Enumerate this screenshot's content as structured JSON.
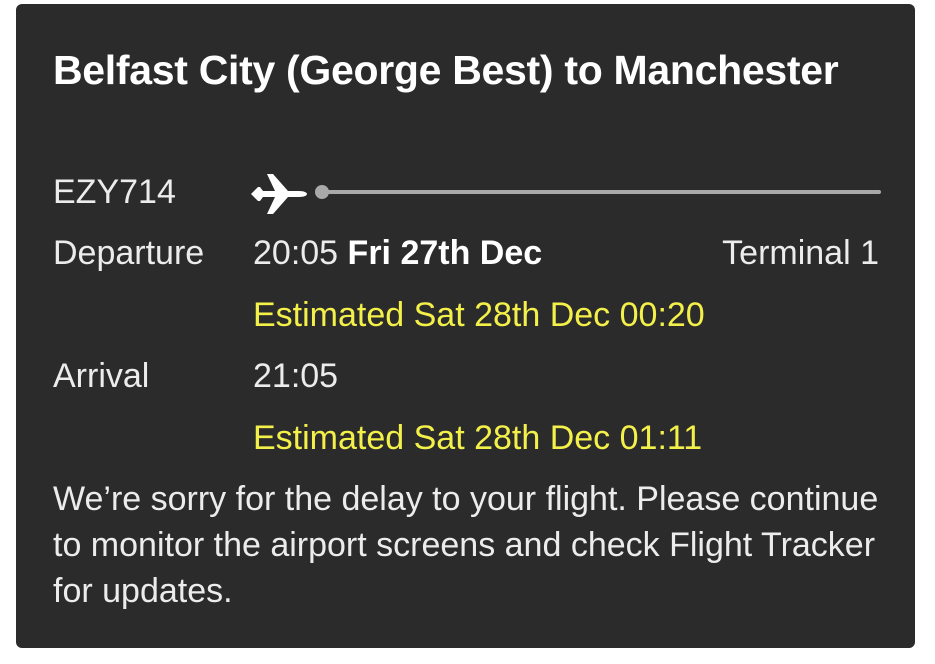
{
  "card": {
    "title": "Belfast City (George Best) to Manchester",
    "flight_number": "EZY714",
    "departure": {
      "label": "Departure",
      "time": "20:05",
      "date": "Fri 27th Dec",
      "terminal": "Terminal 1",
      "estimate": "Estimated Sat 28th Dec 00:20"
    },
    "arrival": {
      "label": "Arrival",
      "time": "21:05",
      "estimate": "Estimated Sat 28th Dec 01:11"
    },
    "notice": "We’re sorry for the delay to your flight. Please continue to monitor the airport screens and check Flight Tracker for updates."
  },
  "icons": {
    "plane": "plane-icon"
  },
  "colors": {
    "card_background": "#2b2b2b",
    "estimate_text": "#f4f04a",
    "track_line": "#a9a9a9"
  }
}
